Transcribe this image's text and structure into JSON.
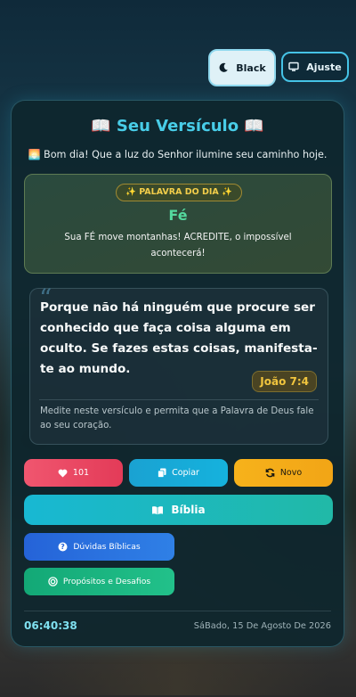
{
  "topbar": {
    "theme_label": "Black",
    "settings_label": "Ajuste",
    "moon_icon": "moon-icon",
    "monitor_icon": "monitor-icon"
  },
  "card": {
    "title": "📖 Seu Versículo 📖",
    "greeting": "🌅 Bom dia! Que a luz do Senhor ilumine seu caminho hoje."
  },
  "word_of_day": {
    "tag": "✨ PALAVRA DO DIA ✨",
    "word": "Fé",
    "description": "Sua FÉ move montanhas! ACREDITE, o impossível acontecerá!"
  },
  "verse": {
    "text": "Porque não há ninguém que procure ser conhecido que faça coisa alguma em oculto. Se fazes estas coisas, manifesta-te ao mundo.",
    "reference": "João 7:4",
    "meditation": "Medite neste versículo e permita que a Palavra de Deus fale ao seu coração."
  },
  "actions": {
    "likes": "101",
    "copy": "Copiar",
    "new": "Novo",
    "bible": "Bíblia",
    "questions": "Dúvidas Bíblicas",
    "challenges": "Propósitos e Desafios"
  },
  "footer": {
    "time": "06:40:38",
    "date": "SáBado, 15 De Agosto De 2026"
  },
  "colors": {
    "accent": "#48cde8",
    "like": "#e33b58",
    "copy": "#15b2dd",
    "new": "#f2a516",
    "bible": "#1fb9b9",
    "questions": "#2f80e6",
    "challenges": "#22c18a",
    "reference": "#f1c53e",
    "word": "#54d99e"
  }
}
